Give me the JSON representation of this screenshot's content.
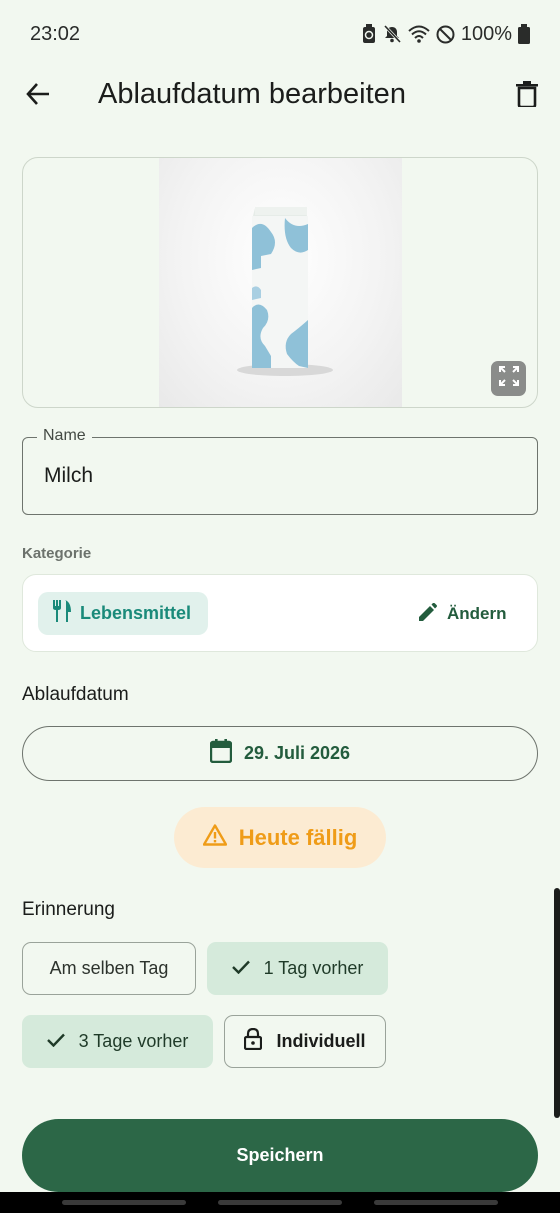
{
  "status_bar": {
    "time": "23:02",
    "battery": "100%",
    "icons": [
      "battery-saver-icon",
      "mute-icon",
      "wifi-icon",
      "do-not-disturb-icon",
      "battery-icon"
    ]
  },
  "app_bar": {
    "title": "Ablaufdatum bearbeiten",
    "back_icon": "arrow-back-icon",
    "delete_icon": "trash-icon"
  },
  "image": {
    "description_icon": "milk-carton",
    "expand_icon": "fullscreen-icon"
  },
  "name_field": {
    "label": "Name",
    "value": "Milch"
  },
  "category": {
    "section_label": "Kategorie",
    "chip_label": "Lebensmittel",
    "chip_icon": "fork-knife-icon",
    "change_label": "Ändern",
    "change_icon": "pencil-icon"
  },
  "expiry": {
    "section_label": "Ablaufdatum",
    "date": "29. Juli 2026",
    "date_icon": "calendar-icon",
    "status": "Heute fällig",
    "status_icon": "warning-icon"
  },
  "reminder": {
    "section_label": "Erinnerung",
    "options": [
      {
        "label": "Am selben Tag",
        "selected": false
      },
      {
        "label": "1 Tag vorher",
        "selected": true
      },
      {
        "label": "3 Tage vorher",
        "selected": true
      },
      {
        "label": "Individuell",
        "selected": false,
        "icon": "lock-icon"
      }
    ]
  },
  "save_label": "Speichern",
  "colors": {
    "background": "#f2f8f0",
    "primary": "#2c6747",
    "accent_teal": "#1a8a7a",
    "warning": "#ef9c18",
    "selected_chip": "#d5eadb"
  }
}
